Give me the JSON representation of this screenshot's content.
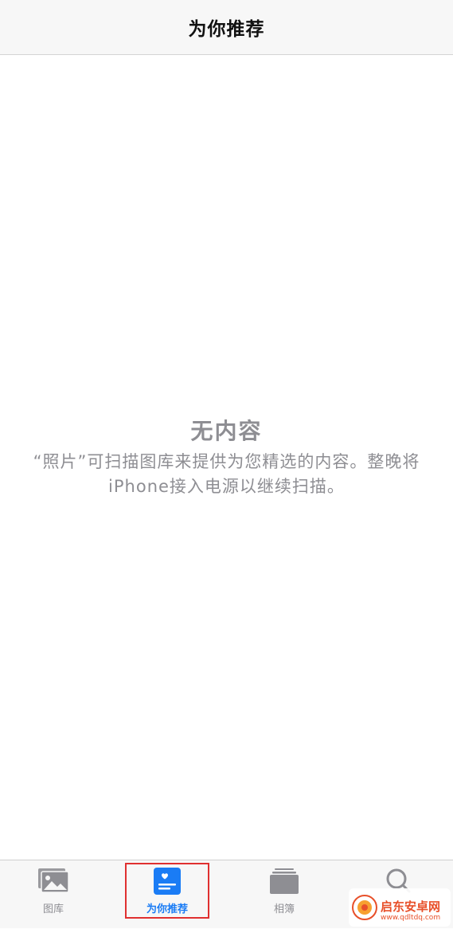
{
  "nav": {
    "title": "为你推荐"
  },
  "empty_state": {
    "title": "无内容",
    "description": "“照片”可扫描图库来提供为您精选的内容。整晚将iPhone接入电源以继续扫描。"
  },
  "tabs": [
    {
      "label": "图库",
      "icon": "photo-library-icon",
      "selected": false
    },
    {
      "label": "为你推荐",
      "icon": "for-you-icon",
      "selected": true
    },
    {
      "label": "相簿",
      "icon": "albums-icon",
      "selected": false
    },
    {
      "label": "",
      "icon": "search-icon",
      "selected": false
    }
  ],
  "watermark": {
    "name": "启东安卓网",
    "url": "www.qdltdq.com"
  },
  "colors": {
    "accent": "#1a7cf5",
    "inactive": "#8e8e93",
    "highlight": "#e03030",
    "watermark": "#e8502a"
  }
}
